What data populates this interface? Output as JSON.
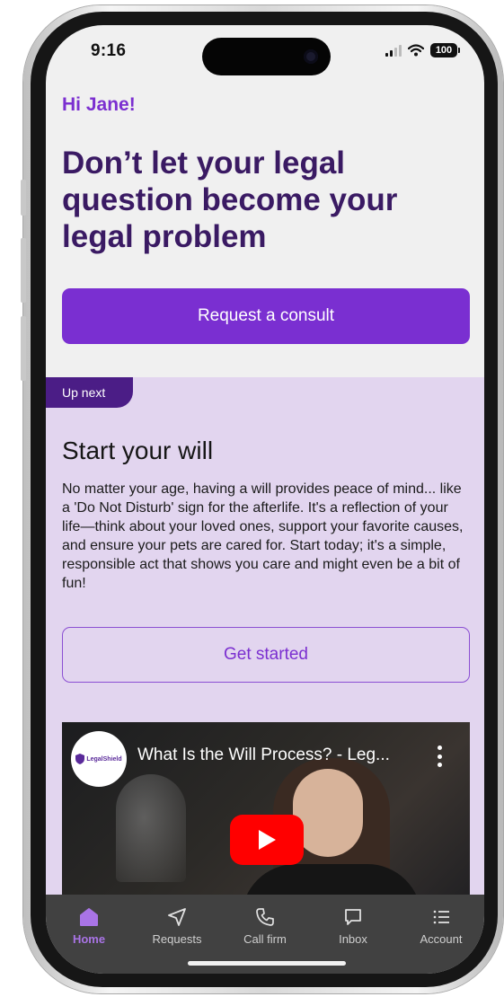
{
  "status_bar": {
    "time": "9:16",
    "battery": "100"
  },
  "home": {
    "greeting": "Hi Jane!",
    "headline": "Don’t let your legal question become your legal problem",
    "consult_button": "Request a consult"
  },
  "up_next": {
    "tag": "Up next",
    "title": "Start your will",
    "description": "No matter your age, having a will provides peace of mind... like a 'Do Not Disturb' sign for the afterlife. It's a reflection of your life—think about your loved ones, support your favorite causes, and ensure your pets are cared for. Start today; it's a simple, responsible act that shows you care and might even be a bit of fun!",
    "cta_button": "Get started"
  },
  "video": {
    "title": "What Is the Will Process? - Leg...",
    "channel_logo": "LegalShield"
  },
  "tab_bar": {
    "items": [
      {
        "label": "Home",
        "icon": "home-icon",
        "active": true
      },
      {
        "label": "Requests",
        "icon": "send-icon",
        "active": false
      },
      {
        "label": "Call firm",
        "icon": "phone-icon",
        "active": false
      },
      {
        "label": "Inbox",
        "icon": "chat-icon",
        "active": false
      },
      {
        "label": "Account",
        "icon": "list-icon",
        "active": false
      }
    ]
  },
  "colors": {
    "accent": "#7a2fd1",
    "heading": "#3a1a63",
    "section_bg": "#e2d5ef",
    "tag_bg": "#4b1d86",
    "tab_bar_bg": "#414141",
    "tab_active": "#a974e6"
  }
}
